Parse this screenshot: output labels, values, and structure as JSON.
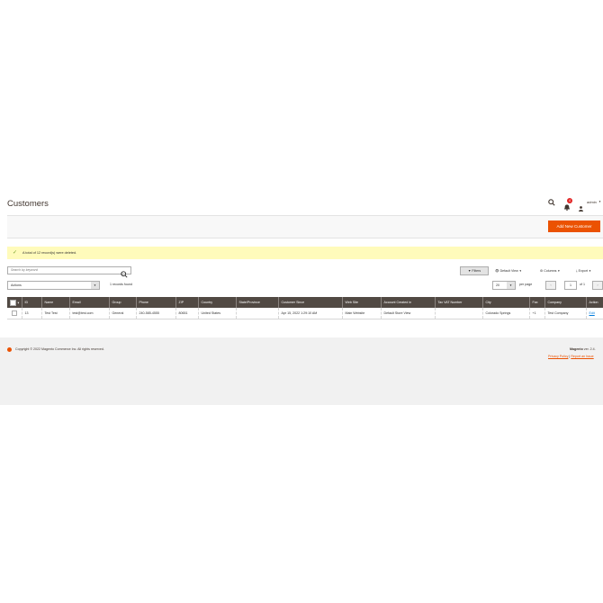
{
  "header": {
    "title": "Customers",
    "notification_count": "4",
    "user_name": "admin"
  },
  "page_actions": {
    "add_label": "Add New Customer"
  },
  "message": {
    "text": "A total of 12 record(s) were deleted."
  },
  "toolbar": {
    "search_placeholder": "Search by keyword",
    "filters_label": "Filters",
    "view_label": "Default View",
    "columns_label": "Columns",
    "export_label": "Export",
    "actions_label": "Actions",
    "records_found": "1 records found",
    "per_page_value": "20",
    "per_page_label": "per page",
    "page_value": "1",
    "page_of": "of 1"
  },
  "table": {
    "columns": [
      "ID",
      "Name",
      "Email",
      "Group",
      "Phone",
      "ZIP",
      "Country",
      "State/Province",
      "Customer Since",
      "Web Site",
      "Account Created in",
      "Tax VAT Number",
      "City",
      "Fax",
      "Company",
      "Action"
    ],
    "rows": [
      [
        "13",
        "Test Test",
        "test@test.com",
        "General",
        "240-585-4555",
        "80651",
        "United States",
        "",
        "Apr 15, 2022 1:29:10 AM",
        "Main Website",
        "Default Store View",
        "",
        "Colorado Springs",
        "+1",
        "Test Company",
        "Edit"
      ]
    ]
  },
  "footer": {
    "copyright": "Copyright © 2022 Magento Commerce Inc. All rights reserved.",
    "version_brand": "Magento",
    "version_text": " ver. 2.4.",
    "privacy_link": "Privacy Policy",
    "report_link": "Report an Issue",
    "separator": "|"
  },
  "colors": {
    "accent": "#eb5202",
    "table_header": "#514943",
    "message_bg": "#fffbbb",
    "success": "#79a22e"
  },
  "icons": [
    "search-icon",
    "bell-icon",
    "user-icon",
    "check-icon",
    "filter-icon",
    "eye-icon",
    "gear-icon",
    "download-icon",
    "magento-logo-icon"
  ]
}
